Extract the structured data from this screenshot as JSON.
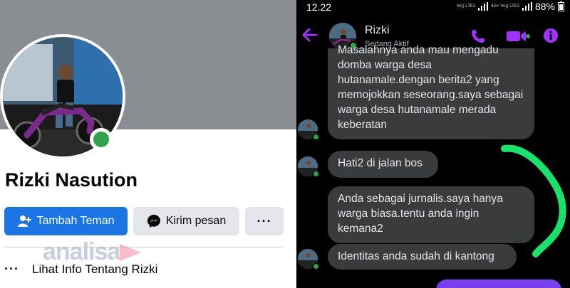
{
  "facebook": {
    "profile_name": "Rizki Nasution",
    "add_friend_label": "Tambah Teman",
    "message_label": "Kirim pesan",
    "more_label": "···",
    "info_dots": "···",
    "info_label": "Lihat Info Tentang Rizki",
    "watermark": "analisa",
    "colors": {
      "primary": "#1b74e4",
      "online": "#31a24c",
      "cover": "#8a8d91"
    }
  },
  "messenger": {
    "status_time": "12.22",
    "network_left": "Vo)) LTE1",
    "network_right": "4G+ Vo)) LTE2",
    "battery": "88%",
    "contact_name": "Rizki",
    "contact_status": "Sedang Aktif",
    "messages": [
      "Masalahnya anda mau mengadu domba warga desa hutanamale.dengan berita2 yang memojokkan seseorang.saya sebagai warga desa hutanamale merada keberatan",
      "Hati2 di jalan bos",
      "Anda sebagai jurnalis.saya hanya warga biasa.tentu anda ingin kemana2",
      "Identitas anda sudah di kantong"
    ],
    "colors": {
      "accent": "#a033ff",
      "bubble": "#3a3b3c",
      "scribble": "#19e26a"
    }
  }
}
